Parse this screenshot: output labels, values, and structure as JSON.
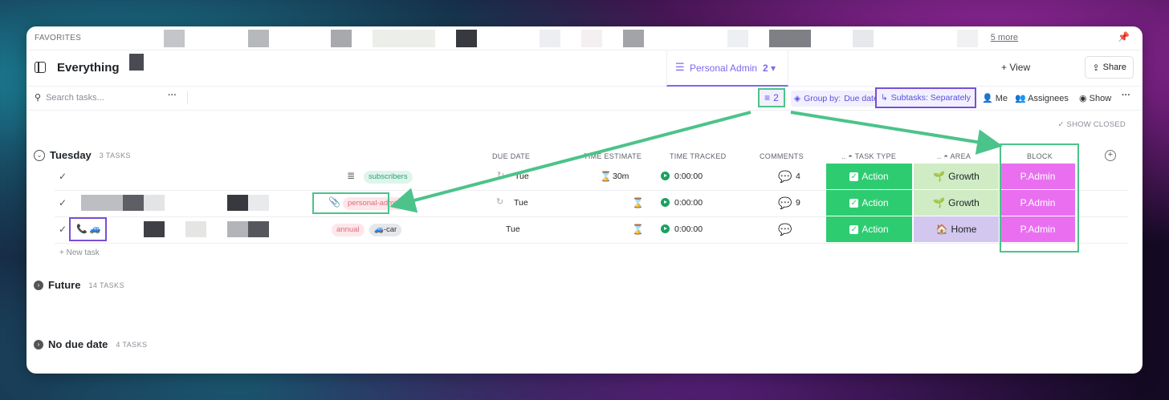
{
  "favorites": {
    "label": "FAVORITES",
    "more_label": "5 more"
  },
  "header": {
    "title": "Everything",
    "tab_label": "Personal Admin",
    "tab_count": "2 ▾",
    "add_view_label": "+ View",
    "share_label": "Share"
  },
  "toolbar": {
    "search_placeholder": "Search tasks...",
    "dots": "···",
    "filter_count": "2",
    "group_by_label": "Group by:",
    "group_by_value": "Due date",
    "subtasks_label": "Subtasks: Separately",
    "me_label": "Me",
    "assignees_label": "Assignees",
    "show_label": "Show",
    "more": "···"
  },
  "show_closed_label": "SHOW CLOSED",
  "columns": {
    "due_date": "DUE DATE",
    "time_estimate": "TIME ESTIMATE",
    "time_tracked": "TIME TRACKED",
    "comments": "COMMENTS",
    "task_type": "TASK TYPE",
    "area": "AREA",
    "block": "BLOCK"
  },
  "groups": {
    "tuesday": {
      "title": "Tuesday",
      "count": "3 TASKS"
    },
    "future": {
      "title": "Future",
      "count": "14 TASKS"
    },
    "no_due": {
      "title": "No due date",
      "count": "4 TASKS"
    }
  },
  "rows": [
    {
      "tag": "subscribers",
      "due": "Tue",
      "estimate": "30m",
      "tracked": "0:00:00",
      "comments": "4",
      "task_type": "Action",
      "area": "Growth",
      "area_icon": "🌱",
      "block": "P.Admin"
    },
    {
      "tag": "personal-admin",
      "due": "Tue",
      "estimate": "",
      "tracked": "0:00:00",
      "comments": "9",
      "task_type": "Action",
      "area": "Growth",
      "area_icon": "🌱",
      "block": "P.Admin"
    },
    {
      "tag": "annual",
      "tag2": "🚙-car",
      "due": "Tue",
      "estimate": "",
      "tracked": "0:00:00",
      "comments": "",
      "task_type": "Action",
      "area": "Home",
      "area_icon": "🏠",
      "block": "P.Admin",
      "icons": "📞 🚙"
    }
  ],
  "new_task_label": "+ New task",
  "colors": {
    "accent": "#7b68ee",
    "highlight_green": "#4cc38a",
    "highlight_purple": "#7a4ed8",
    "task_type_green": "#2ecc71",
    "block_pink": "#e96ff0"
  }
}
